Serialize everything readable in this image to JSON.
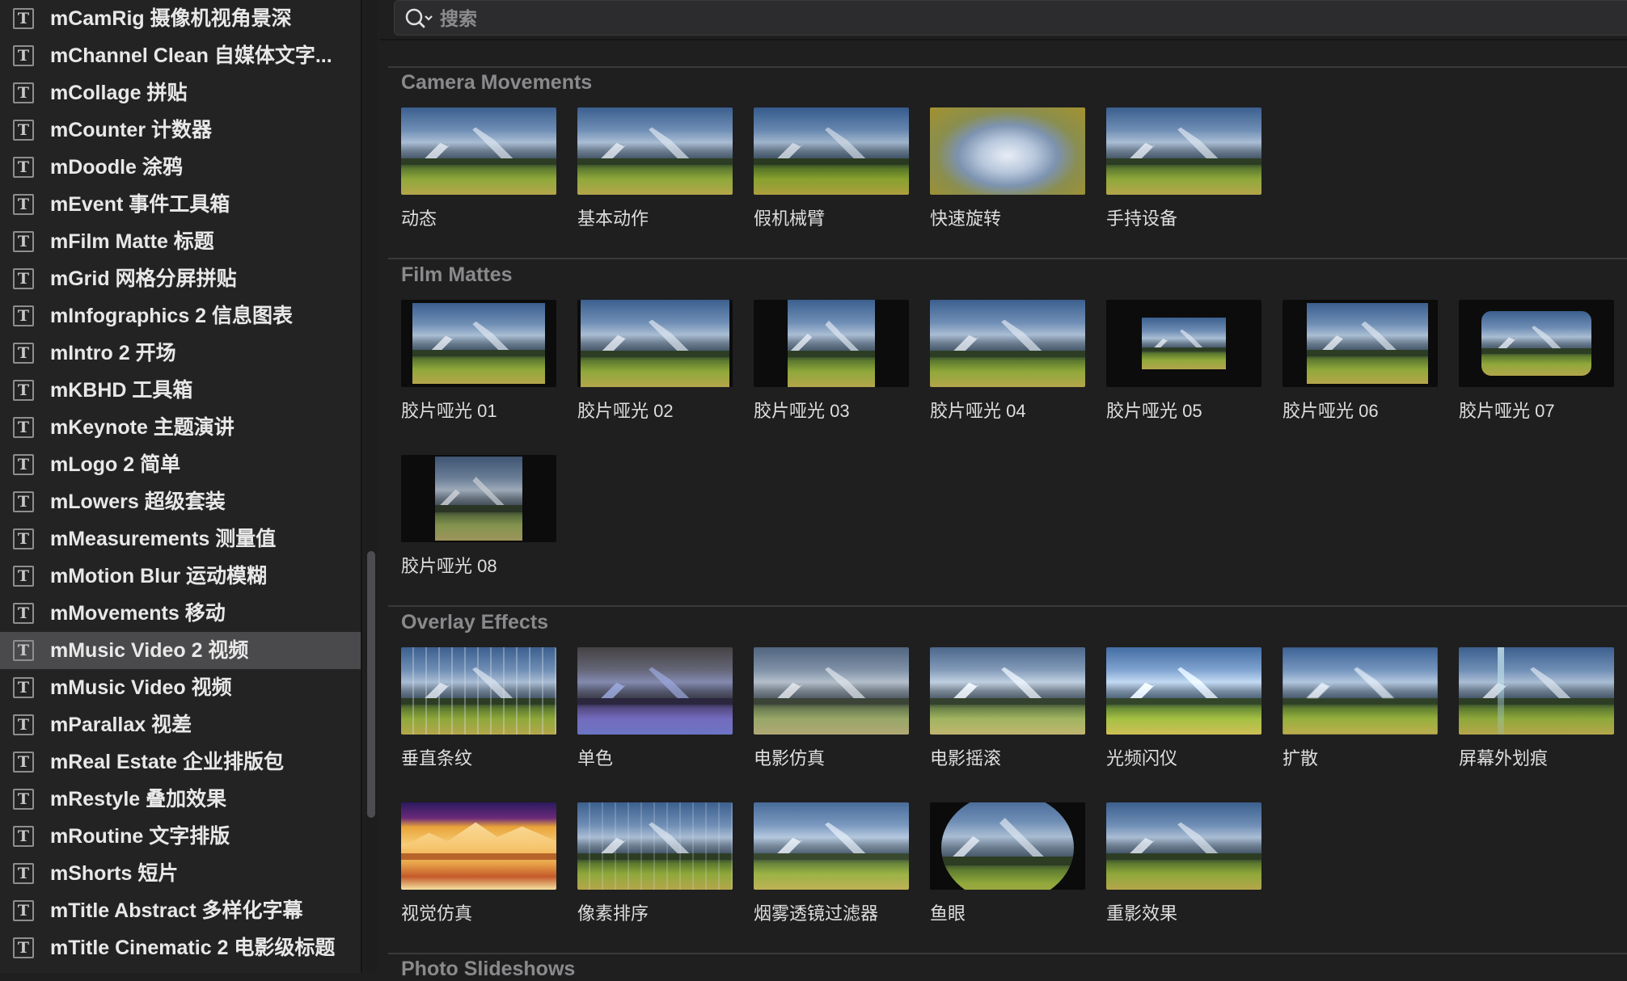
{
  "sidebar": {
    "items": [
      {
        "label": "mCamRig 摄像机视角景深"
      },
      {
        "label": "mChannel Clean 自媒体文字..."
      },
      {
        "label": "mCollage 拼贴"
      },
      {
        "label": "mCounter 计数器"
      },
      {
        "label": "mDoodle 涂鸦"
      },
      {
        "label": "mEvent 事件工具箱"
      },
      {
        "label": "mFilm Matte 标题"
      },
      {
        "label": "mGrid 网格分屏拼贴"
      },
      {
        "label": "mInfographics 2 信息图表"
      },
      {
        "label": "mIntro 2 开场"
      },
      {
        "label": "mKBHD 工具箱"
      },
      {
        "label": "mKeynote 主题演讲"
      },
      {
        "label": "mLogo 2 简单"
      },
      {
        "label": "mLowers 超级套装"
      },
      {
        "label": "mMeasurements 测量值"
      },
      {
        "label": "mMotion Blur 运动模糊"
      },
      {
        "label": "mMovements 移动"
      },
      {
        "label": "mMusic Video 2 视频"
      },
      {
        "label": "mMusic Video 视频"
      },
      {
        "label": "mParallax 视差"
      },
      {
        "label": "mReal Estate 企业排版包"
      },
      {
        "label": "mRestyle 叠加效果"
      },
      {
        "label": "mRoutine 文字排版"
      },
      {
        "label": "mShorts 短片"
      },
      {
        "label": "mTitle Abstract 多样化字幕"
      },
      {
        "label": "mTitle Cinematic 2 电影级标题"
      }
    ],
    "selected": "mMusic Video 2 视频",
    "icon_glyph": "T"
  },
  "search": {
    "placeholder": "搜索"
  },
  "sections": [
    {
      "title": "Camera Movements",
      "tiles": [
        "动态",
        "基本动作",
        "假机械臂",
        "快速旋转",
        "手持设备"
      ]
    },
    {
      "title": "Film Mattes",
      "tiles": [
        "胶片哑光 01",
        "胶片哑光 02",
        "胶片哑光 03",
        "胶片哑光 04",
        "胶片哑光 05",
        "胶片哑光 06",
        "胶片哑光 07",
        "胶片哑光 08"
      ]
    },
    {
      "title": "Overlay Effects",
      "tiles": [
        "垂直条纹",
        "单色",
        "电影仿真",
        "电影摇滚",
        "光频闪仪",
        "扩散",
        "屏幕外划痕",
        "视觉仿真",
        "像素排序",
        "烟雾透镜过滤器",
        "鱼眼",
        "重影效果"
      ]
    },
    {
      "title": "Photo Slideshows",
      "tiles": []
    }
  ],
  "colors": {
    "background": "#1f1f20",
    "sidebar_bg": "#232324",
    "selected_row": "#4a4a4c",
    "section_title": "#8a8a8c"
  }
}
